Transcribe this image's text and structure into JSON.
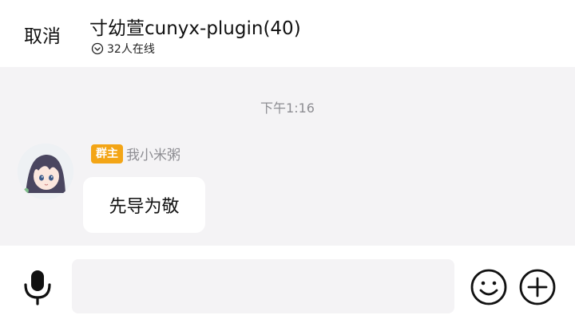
{
  "header": {
    "cancel_label": "取消",
    "title": "寸幼萱cunyx-plugin(40)",
    "online_text": "32人在线",
    "online_icon": "chevron-down-circle-icon"
  },
  "chat": {
    "timestamp": "下午1:16",
    "messages": [
      {
        "badge": "群主",
        "sender": "我小米粥",
        "text": "先导为敬",
        "avatar": "anime-girl-avatar"
      }
    ]
  },
  "input_bar": {
    "placeholder": "",
    "icons": [
      "microphone-icon",
      "emoji-icon",
      "plus-circle-icon"
    ]
  },
  "colors": {
    "badge": "#f3a516",
    "chat_background": "#f4f3f5",
    "muted_text": "#8e8e93"
  }
}
